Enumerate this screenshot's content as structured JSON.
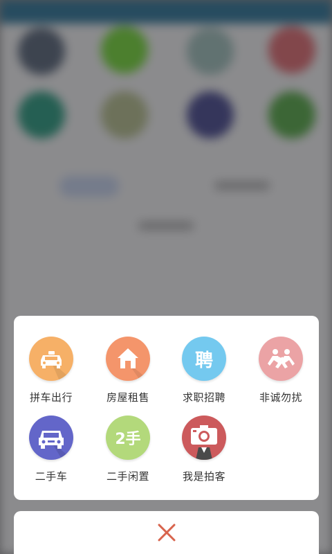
{
  "colors": {
    "taxi": "#f6b067",
    "house": "#f4956b",
    "job": "#74c9ef",
    "nodisturb": "#eba3a5",
    "car": "#6366c9",
    "secondhand": "#b3d97b",
    "camera": "#cc5a5c",
    "close": "#d8644d"
  },
  "menu": {
    "items": [
      {
        "label": "拼车出行",
        "icon": "taxi-icon"
      },
      {
        "label": "房屋租售",
        "icon": "house-icon"
      },
      {
        "label": "求职招聘",
        "icon": "hire-icon",
        "glyph": "聘"
      },
      {
        "label": "非诚勿扰",
        "icon": "dating-icon"
      },
      {
        "label": "二手车",
        "icon": "car-icon"
      },
      {
        "label": "二手闲置",
        "icon": "secondhand-icon",
        "glyph": "2手"
      },
      {
        "label": "我是拍客",
        "icon": "camera-icon"
      }
    ]
  },
  "cancel": {
    "icon": "close-icon"
  }
}
